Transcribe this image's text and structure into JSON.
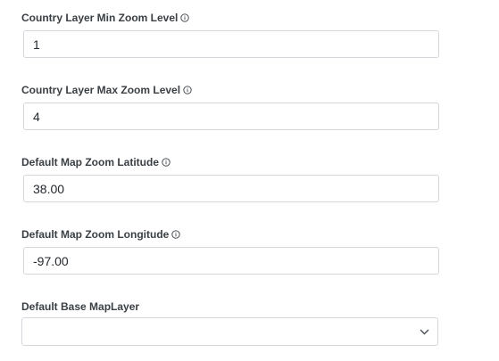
{
  "fields": [
    {
      "label": "Country Layer Min Zoom Level",
      "value": "1",
      "icon": "info-icon"
    },
    {
      "label": "Country Layer Max Zoom Level",
      "value": "4",
      "icon": "info-icon"
    },
    {
      "label": "Default Map Zoom Latitude",
      "value": "38.00",
      "icon": "info-icon"
    },
    {
      "label": "Default Map Zoom Longitude",
      "value": "-97.00",
      "icon": "info-icon"
    }
  ],
  "base_layer": {
    "label": "Default Base MapLayer",
    "selected": "",
    "icon": "chevron-down-icon"
  },
  "colors": {
    "label_text": "#3a3f44",
    "input_border": "#d3d6da",
    "input_text": "#24292e"
  }
}
